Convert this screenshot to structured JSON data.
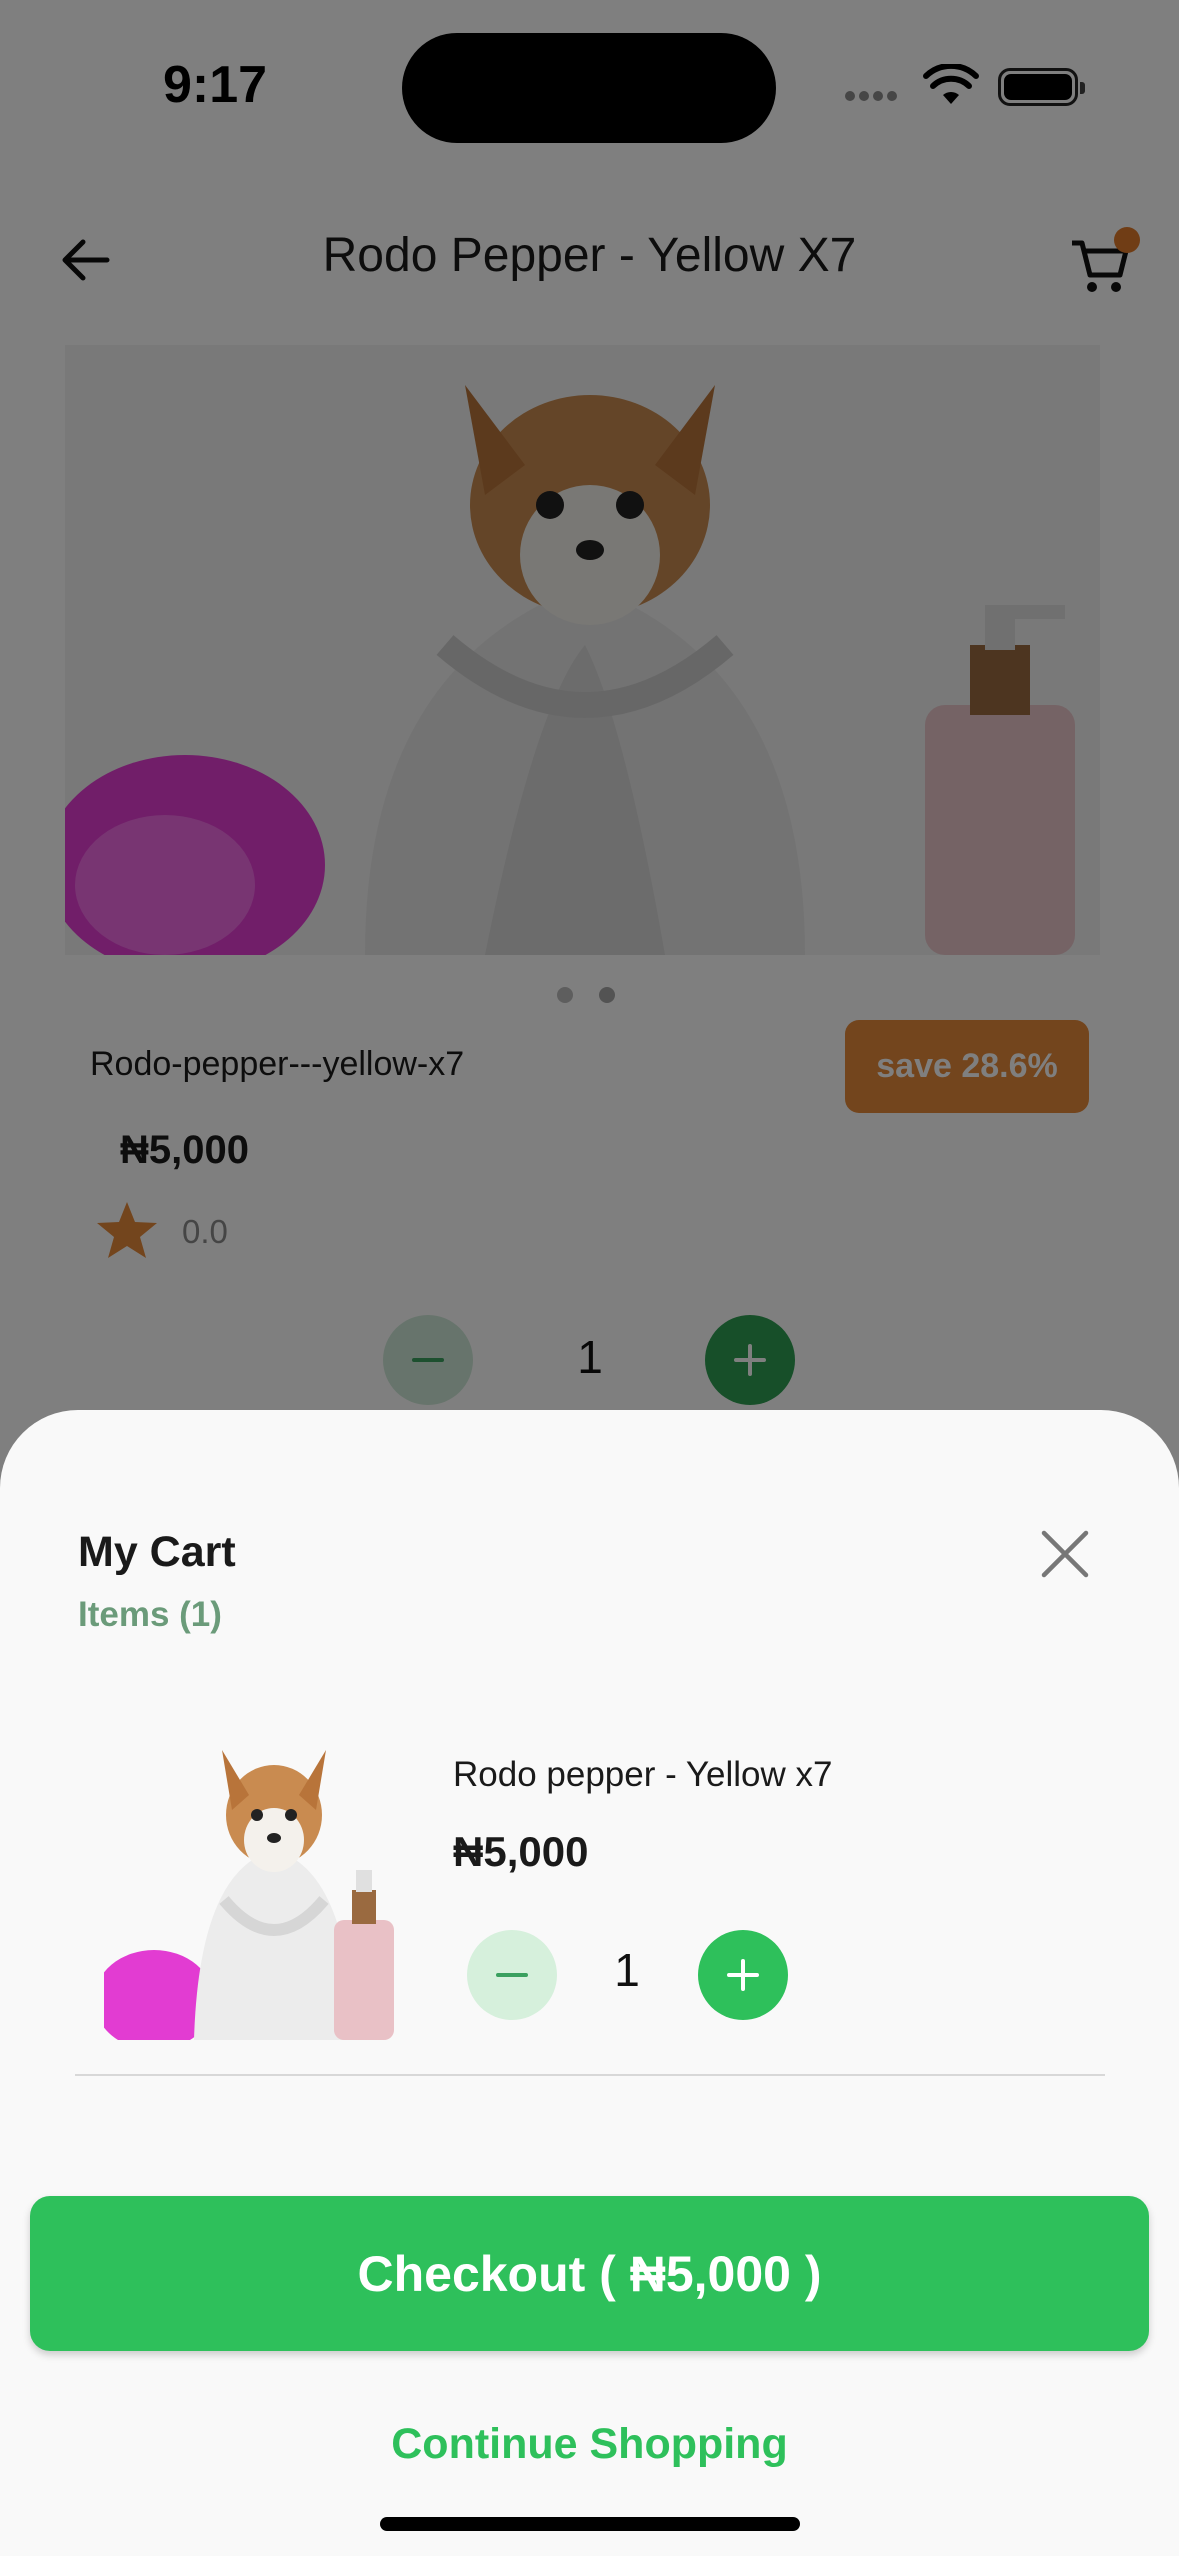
{
  "status_bar": {
    "time": "9:17"
  },
  "header": {
    "title": "Rodo Pepper - Yellow X7"
  },
  "product": {
    "slug": "Rodo-pepper---yellow-x7",
    "save_badge": "save 28.6%",
    "price": "₦5,000",
    "rating": "0.0",
    "quantity": "1",
    "carousel_pages": 2,
    "carousel_active": 1
  },
  "cart_sheet": {
    "title": "My Cart",
    "items_count_label": "Items (1)",
    "items": [
      {
        "name": "Rodo pepper - Yellow x7",
        "price": "₦5,000",
        "quantity": "1"
      }
    ],
    "checkout_label": "Checkout ( ₦5,000 )",
    "continue_label": "Continue Shopping"
  },
  "colors": {
    "accent_green": "#2ec05b",
    "dark_green": "#2e9e52",
    "badge_orange": "#e68a3a",
    "cart_dot": "#e07b2a"
  },
  "icons": {
    "back": "arrow-left-icon",
    "cart": "shopping-cart-icon",
    "close": "close-icon",
    "star": "star-icon",
    "minus": "minus-icon",
    "plus": "plus-icon"
  }
}
